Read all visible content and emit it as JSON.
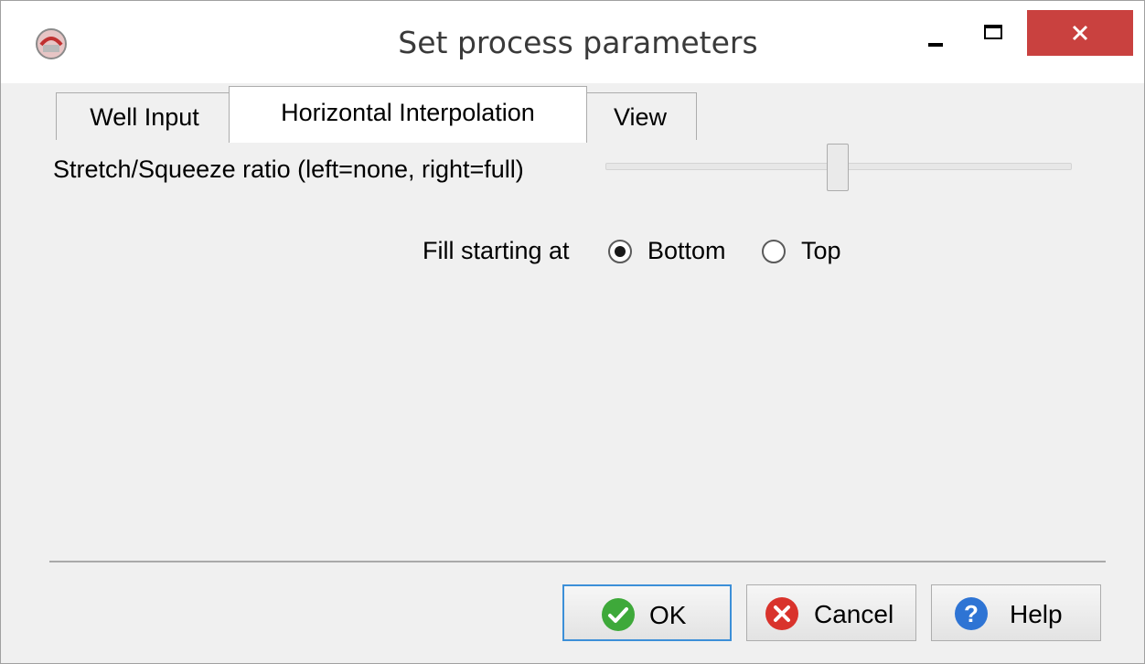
{
  "window": {
    "title": "Set process parameters"
  },
  "tabs": [
    {
      "label": "Well Input",
      "selected": false
    },
    {
      "label": "Horizontal Interpolation",
      "selected": true
    },
    {
      "label": "View",
      "selected": false
    }
  ],
  "slider": {
    "label": "Stretch/Squeeze ratio (left=none, right=full)",
    "value_fraction": 0.5
  },
  "fill": {
    "label": "Fill starting at",
    "options": [
      {
        "label": "Bottom",
        "checked": true
      },
      {
        "label": "Top",
        "checked": false
      }
    ]
  },
  "buttons": {
    "ok": "OK",
    "cancel": "Cancel",
    "help": "Help"
  },
  "colors": {
    "close_button": "#c9413f",
    "ok_icon": "#3ea93a",
    "cancel_icon": "#d9332c",
    "help_icon": "#2e74d4",
    "focus_border": "#3c8fd8"
  },
  "icons": {
    "app": "app-logo-icon",
    "minimize": "minimize-icon",
    "maximize": "maximize-icon",
    "close": "close-icon",
    "ok": "checkmark-icon",
    "cancel": "cancel-x-icon",
    "help": "question-icon"
  }
}
